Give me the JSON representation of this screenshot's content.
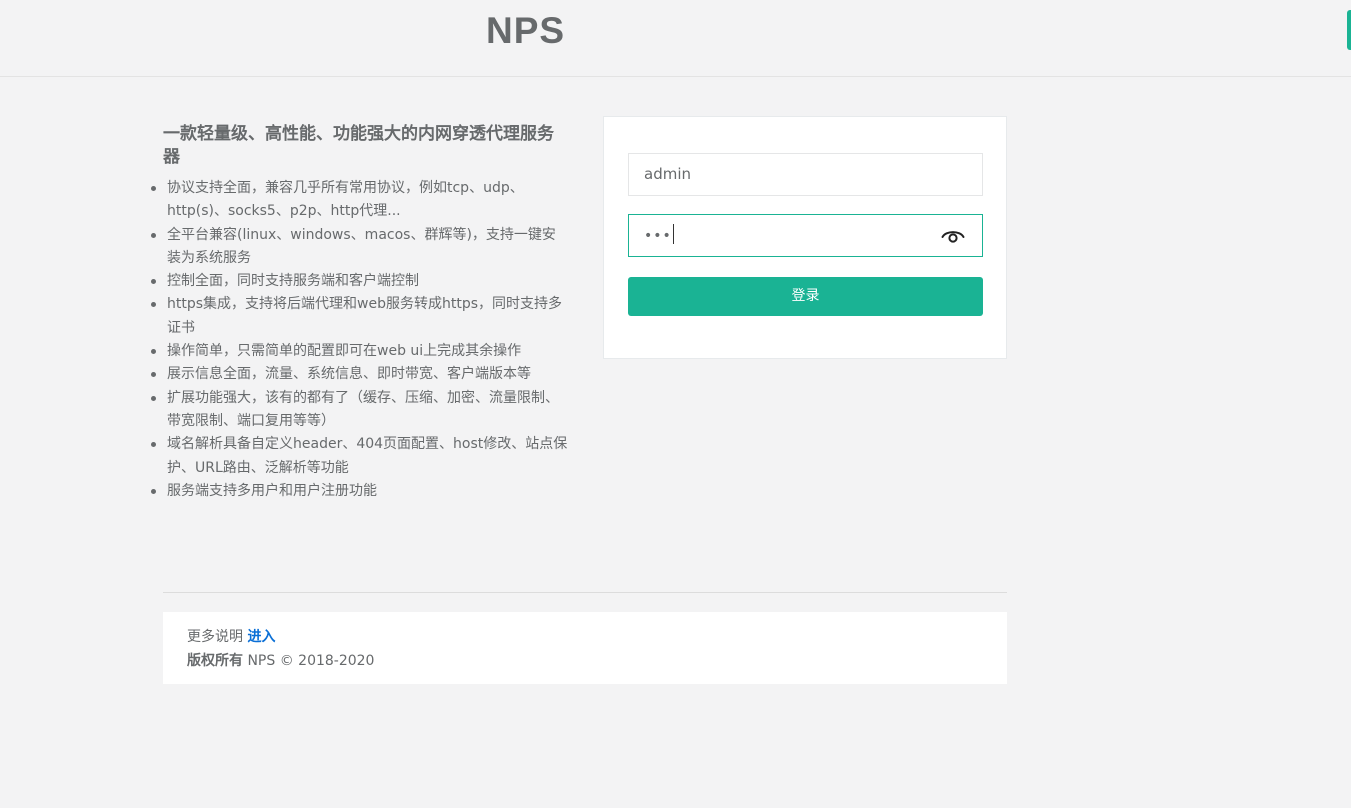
{
  "header": {
    "logo": "NPS"
  },
  "intro": {
    "title": "一款轻量级、高性能、功能强大的内网穿透代理服务器",
    "features": [
      "协议支持全面，兼容几乎所有常用协议，例如tcp、udp、http(s)、socks5、p2p、http代理...",
      "全平台兼容(linux、windows、macos、群辉等)，支持一键安装为系统服务",
      "控制全面，同时支持服务端和客户端控制",
      "https集成，支持将后端代理和web服务转成https，同时支持多证书",
      "操作简单，只需简单的配置即可在web ui上完成其余操作",
      "展示信息全面，流量、系统信息、即时带宽、客户端版本等",
      "扩展功能强大，该有的都有了（缓存、压缩、加密、流量限制、带宽限制、端口复用等等）",
      "域名解析具备自定义header、404页面配置、host修改、站点保护、URL路由、泛解析等功能",
      "服务端支持多用户和用户注册功能"
    ]
  },
  "login": {
    "username": "admin",
    "password_mask": "•••",
    "password_toggle_icon": "eye-icon",
    "submit_label": "登录"
  },
  "footer": {
    "more_label": "更多说明",
    "more_link": "进入",
    "copyright_label": "版权所有",
    "copyright_text": "NPS © 2018-2020"
  },
  "colors": {
    "accent": "#1ab394",
    "link": "#0a6fd6",
    "text": "#676a6c",
    "background": "#f3f3f4"
  }
}
